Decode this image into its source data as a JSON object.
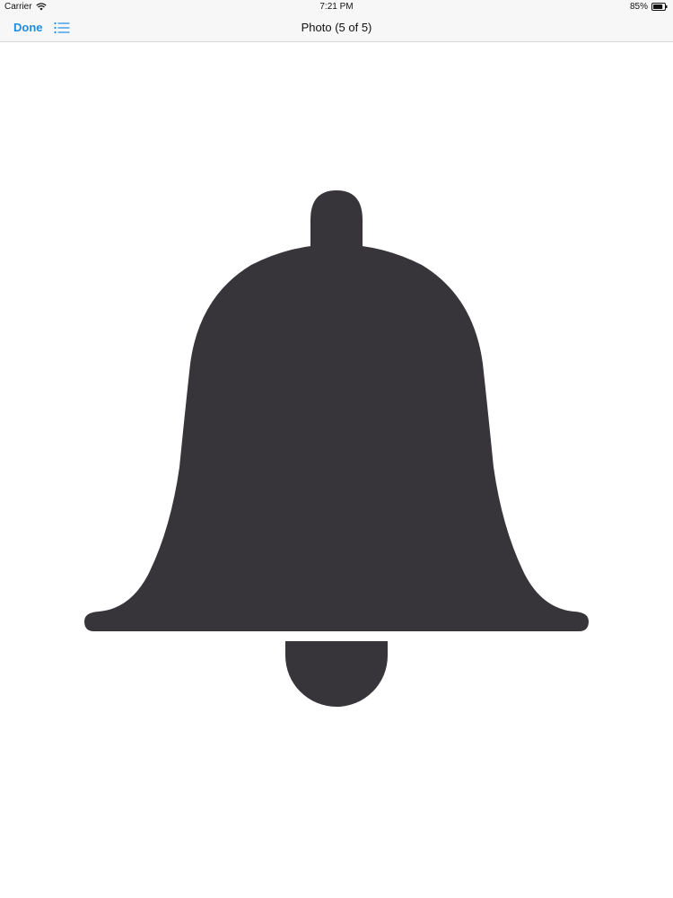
{
  "status_bar": {
    "carrier": "Carrier",
    "time": "7:21 PM",
    "battery": "85%",
    "battery_level": 0.85
  },
  "nav_bar": {
    "done_label": "Done",
    "list_icon": "list-icon",
    "title": "Photo (5 of 5)"
  },
  "photo": {
    "icon": "bell-icon",
    "fill_color": "#38353a"
  },
  "colors": {
    "accent": "#1d8de0",
    "bar_background": "#f7f7f8"
  }
}
